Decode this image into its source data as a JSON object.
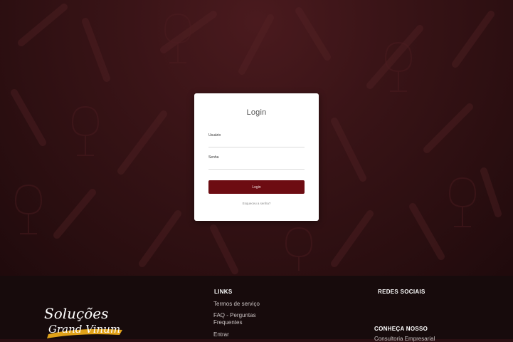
{
  "login": {
    "title": "Login",
    "username_label": "Usuário",
    "password_label": "Senha",
    "username_value": "",
    "password_value": "",
    "submit_label": "Login",
    "forgot_password": "Esqueceu a senha?"
  },
  "footer": {
    "logo_line1": "Soluções",
    "logo_line2": "Grand Vinum",
    "links_heading": "LINKS",
    "links": [
      "Termos de serviço",
      "FAQ - Perguntas Frequentes",
      "Entrar"
    ],
    "social_heading": "REDES SOCIAIS",
    "know_heading": "CONHEÇA NOSSO",
    "know_partial": "Consultoria Empresarial"
  },
  "colors": {
    "primary": "#6d0c12",
    "hero_bg": "#3a1417",
    "footer_bg": "#170b0c",
    "logo_accent": "#e0a21a"
  }
}
